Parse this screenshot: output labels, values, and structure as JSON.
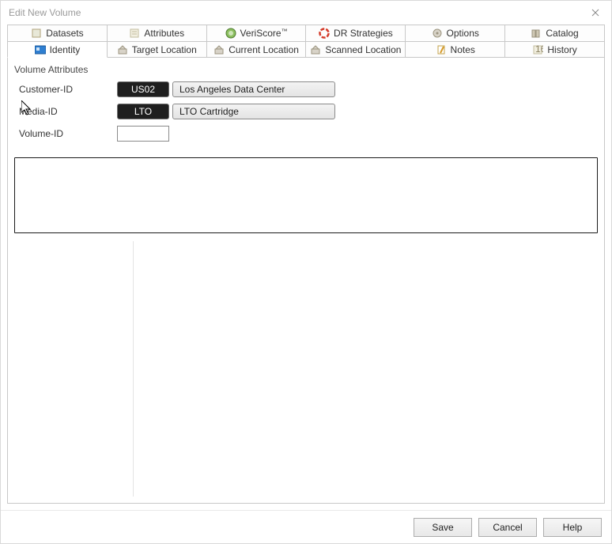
{
  "window": {
    "title": "Edit New Volume"
  },
  "tabs_top": [
    {
      "id": "datasets",
      "label": "Datasets",
      "icon": "datasets-icon"
    },
    {
      "id": "attributes",
      "label": "Attributes",
      "icon": "attributes-icon"
    },
    {
      "id": "veriscore",
      "label": "VeriScore™",
      "icon": "veriscore-icon"
    },
    {
      "id": "dr",
      "label": "DR Strategies",
      "icon": "dr-icon"
    },
    {
      "id": "options",
      "label": "Options",
      "icon": "options-icon"
    },
    {
      "id": "catalog",
      "label": "Catalog",
      "icon": "catalog-icon"
    }
  ],
  "tabs_bottom": [
    {
      "id": "identity",
      "label": "Identity",
      "icon": "identity-icon",
      "active": true
    },
    {
      "id": "target",
      "label": "Target Location",
      "icon": "target-icon"
    },
    {
      "id": "current",
      "label": "Current Location",
      "icon": "current-icon"
    },
    {
      "id": "scanned",
      "label": "Scanned Location",
      "icon": "scanned-icon"
    },
    {
      "id": "notes",
      "label": "Notes",
      "icon": "notes-icon"
    },
    {
      "id": "history",
      "label": "History",
      "icon": "history-icon"
    }
  ],
  "group": {
    "title": "Volume Attributes"
  },
  "fields": {
    "customer": {
      "label": "Customer-ID",
      "code": "US02",
      "desc": "Los Angeles Data Center"
    },
    "media": {
      "label": "Media-ID",
      "code": "LTO",
      "desc": "LTO Cartridge"
    },
    "volume": {
      "label": "Volume-ID",
      "value": ""
    }
  },
  "footer": {
    "save": "Save",
    "cancel": "Cancel",
    "help": "Help"
  }
}
